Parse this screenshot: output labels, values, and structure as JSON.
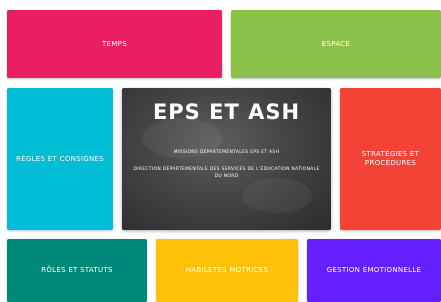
{
  "tiles": {
    "temps": {
      "label": "TEMPS",
      "color": "#E91E63"
    },
    "espace": {
      "label": "ESPACE",
      "color": "#8BC34A"
    },
    "regles": {
      "label": "RÈGLES ET CONSIGNES",
      "color": "#00BCD4"
    },
    "strategies": {
      "label": "STRATÉGIES ET PROCÉDURES",
      "color": "#F44336"
    },
    "roles": {
      "label": "RÔLES ET STATUTS",
      "color": "#00897B"
    },
    "habiletes": {
      "label": "HABILETÉS MOTRICES",
      "color": "#FFC107"
    },
    "gestion": {
      "label": "GESTION ÉMOTIONNELLE",
      "color": "#651FFF"
    }
  },
  "center": {
    "title": "EPS ET ASH",
    "line1": "MISSIONS DÉPARTEMENTALES EPS ET ASH",
    "line2": "DIRECTION DÉPARTEMENTALE DES SERVICES DE L'ÉDUCATION NATIONALE DU NORD"
  }
}
